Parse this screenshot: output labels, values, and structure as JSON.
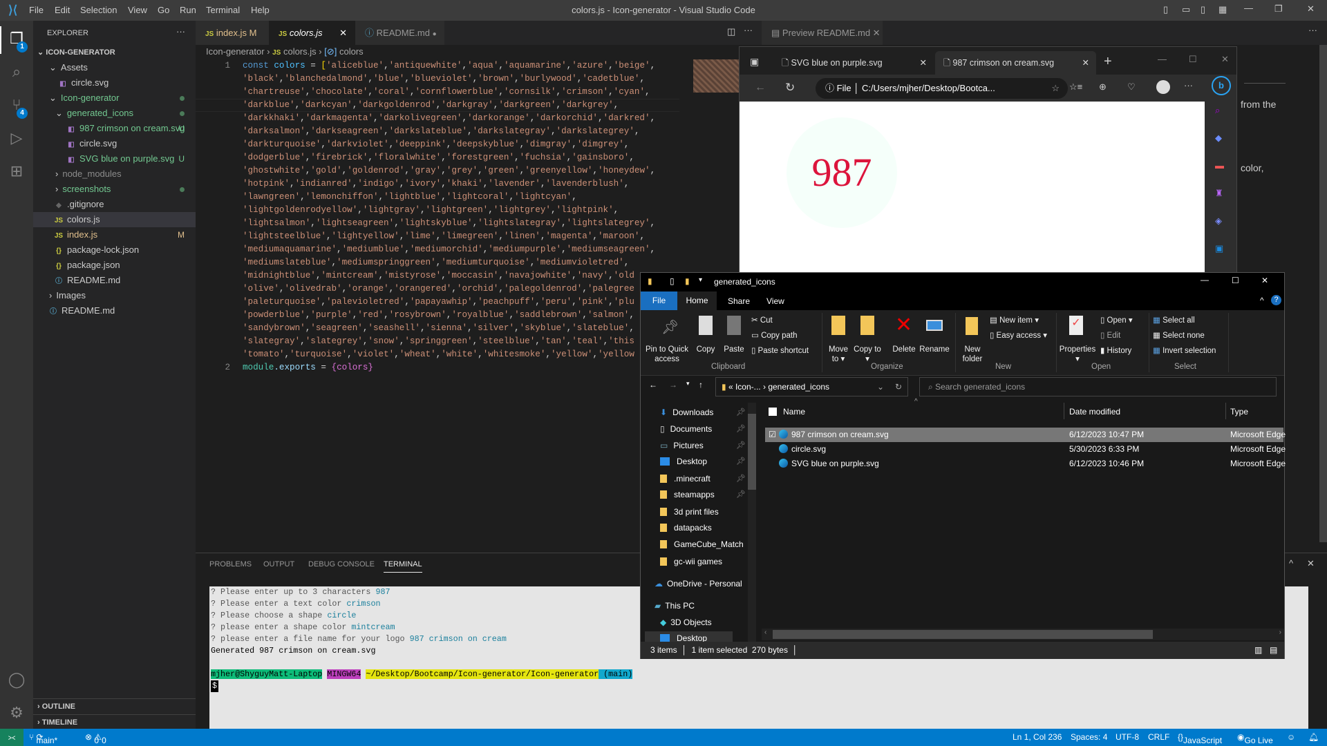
{
  "window": {
    "title": "colors.js - Icon-generator - Visual Studio Code",
    "menu": [
      "File",
      "Edit",
      "Selection",
      "View",
      "Go",
      "Run",
      "Terminal",
      "Help"
    ]
  },
  "activity": {
    "explorer_badge": "1",
    "scm_badge": "4"
  },
  "sidebar": {
    "title": "EXPLORER",
    "more": "···",
    "root": "ICON-GENERATOR",
    "items": [
      {
        "label": "Assets",
        "kind": "folder"
      },
      {
        "label": "circle.svg",
        "kind": "svg"
      },
      {
        "label": "Icon-generator",
        "kind": "folder"
      },
      {
        "label": "generated_icons",
        "kind": "folder"
      },
      {
        "label": "987 crimson on cream.svg",
        "kind": "svg",
        "flag": "U"
      },
      {
        "label": "circle.svg",
        "kind": "svg"
      },
      {
        "label": "SVG blue on purple.svg",
        "kind": "svg",
        "flag": "U"
      },
      {
        "label": "node_modules",
        "kind": "folder"
      },
      {
        "label": "screenshots",
        "kind": "folder"
      },
      {
        "label": ".gitignore",
        "kind": "git"
      },
      {
        "label": "colors.js",
        "kind": "js"
      },
      {
        "label": "index.js",
        "kind": "js",
        "flag": "M"
      },
      {
        "label": "package-lock.json",
        "kind": "json"
      },
      {
        "label": "package.json",
        "kind": "json"
      },
      {
        "label": "README.md",
        "kind": "info"
      },
      {
        "label": "Images",
        "kind": "folder"
      },
      {
        "label": "README.md",
        "kind": "info"
      }
    ],
    "outline": "OUTLINE",
    "timeline": "TIMELINE"
  },
  "editor": {
    "tabs": [
      {
        "label": "index.js",
        "flag": "M"
      },
      {
        "label": "colors.js"
      },
      {
        "label": "README.md"
      }
    ],
    "preview_tab": "Preview README.md",
    "breadcrumb": [
      "Icon-generator",
      "colors.js",
      "colors"
    ],
    "line_numbers": [
      "1",
      "2"
    ],
    "line1": {
      "keyword": "const",
      "var": "colors",
      "op": " = ",
      "bracket": "[",
      "first": "'aliceblue','antiquewhite','aqua','aquamarine','azure','beige',"
    },
    "wrapped": [
      "'black','blanchedalmond','blue','blueviolet','brown','burlywood','cadetblue',",
      "'chartreuse','chocolate','coral','cornflowerblue','cornsilk','crimson','cyan',",
      "'darkblue','darkcyan','darkgoldenrod','darkgray','darkgreen','darkgrey',",
      "'darkkhaki','darkmagenta','darkolivegreen','darkorange','darkorchid','darkred',",
      "'darksalmon','darkseagreen','darkslateblue','darkslategray','darkslategrey',",
      "'darkturquoise','darkviolet','deeppink','deepskyblue','dimgray','dimgrey',",
      "'dodgerblue','firebrick','floralwhite','forestgreen','fuchsia','gainsboro',",
      "'ghostwhite','gold','goldenrod','gray','grey','green','greenyellow','honeydew',",
      "'hotpink','indianred','indigo','ivory','khaki','lavender','lavenderblush',",
      "'lawngreen','lemonchiffon','lightblue','lightcoral','lightcyan',",
      "'lightgoldenrodyellow','lightgray','lightgreen','lightgrey','lightpink',",
      "'lightsalmon','lightseagreen','lightskyblue','lightslategray','lightslategrey',",
      "'lightsteelblue','lightyellow','lime','limegreen','linen','magenta','maroon',",
      "'mediumaquamarine','mediumblue','mediumorchid','mediumpurple','mediumseagreen',",
      "'mediumslateblue','mediumspringgreen','mediumturquoise','mediumvioletred',",
      "'midnightblue','mintcream','mistyrose','moccasin','navajowhite','navy','old",
      "'olive','olivedrab','orange','orangered','orchid','palegoldenrod','palegree",
      "'paleturquoise','palevioletred','papayawhip','peachpuff','peru','pink','plu",
      "'powderblue','purple','red','rosybrown','royalblue','saddlebrown','salmon',",
      "'sandybrown','seagreen','seashell','sienna','silver','skyblue','slateblue',",
      "'slategray','slategrey','snow','springgreen','steelblue','tan','teal','this",
      "'tomato','turquoise','violet','wheat','white','whitesmoke','yellow','yellow"
    ],
    "line2": {
      "module": "module",
      "exports": ".exports",
      "op": " = ",
      "value": "{colors}"
    },
    "preview_text": [
      "from the",
      "color,"
    ]
  },
  "panel": {
    "tabs": [
      "PROBLEMS",
      "OUTPUT",
      "DEBUG CONSOLE",
      "TERMINAL"
    ],
    "terminal": [
      {
        "q": "? Please enter up to 3 characters ",
        "a": "987"
      },
      {
        "q": "? Please enter a text color ",
        "a": "crimson"
      },
      {
        "q": "? Please choose a shape ",
        "a": "circle"
      },
      {
        "q": "? please enter a shape color ",
        "a": "mintcream"
      },
      {
        "q": "? please enter a file name for your logo ",
        "a": "987 crimson on cream"
      }
    ],
    "generated": "Generated 987 crimson on cream.svg",
    "prompt": {
      "user": "mjher@ShyguyMatt-Laptop",
      "env": "MINGW64",
      "path": "~/Desktop/Bootcamp/Icon-generator/Icon-generator",
      "branch": "(main)"
    },
    "cursor": "$"
  },
  "statusbar": {
    "branch": "main*",
    "errors": "0",
    "warnings": "0",
    "position": "Ln 1, Col 236",
    "spaces": "Spaces: 4",
    "encoding": "UTF-8",
    "eol": "CRLF",
    "language": "JavaScript",
    "golive": "Go Live"
  },
  "browser": {
    "tabs": [
      "SVG blue on purple.svg",
      "987 crimson on cream.svg"
    ],
    "scheme": "File",
    "url": "C:/Users/mjher/Desktop/Bootca...",
    "svg": {
      "text": "987",
      "text_color": "#dc143c",
      "shape": "circle",
      "shape_color": "#f5fffa"
    }
  },
  "explorer": {
    "title": "generated_icons",
    "ribbon_tabs": [
      "File",
      "Home",
      "Share",
      "View"
    ],
    "ribbon": {
      "pin": "Pin to Quick access",
      "copy": "Copy",
      "paste": "Paste",
      "cut": "Cut",
      "copy_path": "Copy path",
      "paste_shortcut": "Paste shortcut",
      "move_to": "Move to",
      "copy_to": "Copy to",
      "delete": "Delete",
      "rename": "Rename",
      "new_folder": "New folder",
      "new_item": "New item",
      "easy_access": "Easy access",
      "properties": "Properties",
      "open": "Open",
      "edit": "Edit",
      "history": "History",
      "select_all": "Select all",
      "select_none": "Select none",
      "invert": "Invert selection"
    },
    "groups": [
      "Clipboard",
      "Organize",
      "New",
      "Open",
      "Select"
    ],
    "address": [
      "Icon-...",
      "generated_icons"
    ],
    "search_placeholder": "Search generated_icons",
    "nav": [
      {
        "label": "Downloads",
        "pin": true
      },
      {
        "label": "Documents",
        "pin": true
      },
      {
        "label": "Pictures",
        "pin": true
      },
      {
        "label": "Desktop",
        "pin": true
      },
      {
        "label": ".minecraft",
        "pin": true
      },
      {
        "label": "steamapps",
        "pin": true
      },
      {
        "label": "3d print files"
      },
      {
        "label": "datapacks"
      },
      {
        "label": "GameCube_Match"
      },
      {
        "label": "gc-wii games"
      },
      {
        "label": "OneDrive - Personal"
      },
      {
        "label": "This PC"
      },
      {
        "label": "3D Objects"
      },
      {
        "label": "Desktop"
      }
    ],
    "columns": [
      "Name",
      "Date modified",
      "Type"
    ],
    "files": [
      {
        "name": "987 crimson on cream.svg",
        "date": "6/12/2023 10:47 PM",
        "type": "Microsoft Edge",
        "selected": true
      },
      {
        "name": "circle.svg",
        "date": "5/30/2023 6:33 PM",
        "type": "Microsoft Edge"
      },
      {
        "name": "SVG blue on purple.svg",
        "date": "6/12/2023 10:46 PM",
        "type": "Microsoft Edge"
      }
    ],
    "status": {
      "items": "3 items",
      "selected": "1 item selected",
      "size": "270 bytes"
    }
  }
}
